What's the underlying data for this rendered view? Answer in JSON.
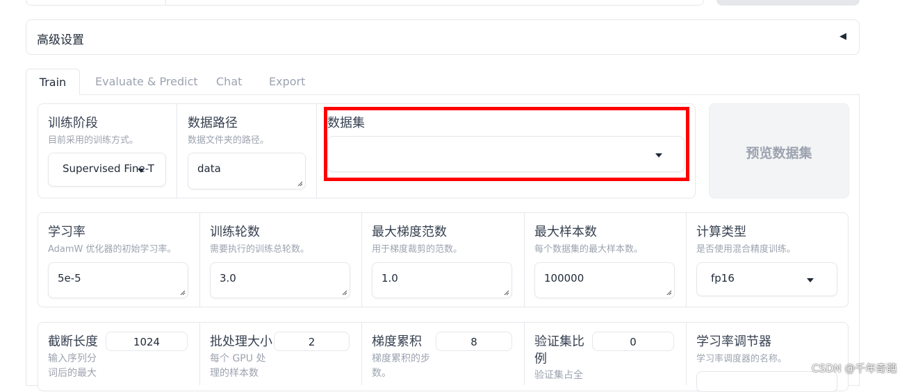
{
  "advanced": {
    "title": "高级设置"
  },
  "tabs": [
    "Train",
    "Evaluate & Predict",
    "Chat",
    "Export"
  ],
  "row1": {
    "stage": {
      "label": "训练阶段",
      "info": "目前采用的训练方式。",
      "value": "Supervised Fine-T"
    },
    "data_dir": {
      "label": "数据路径",
      "info": "数据文件夹的路径。",
      "value": "data"
    },
    "dataset": {
      "label": "数据集",
      "value": ""
    },
    "preview_button": "预览数据集"
  },
  "row2": [
    {
      "label": "学习率",
      "info": "AdamW 优化器的初始学习率。",
      "value": "5e-5"
    },
    {
      "label": "训练轮数",
      "info": "需要执行的训练总轮数。",
      "value": "3.0"
    },
    {
      "label": "最大梯度范数",
      "info": "用于梯度裁剪的范数。",
      "value": "1.0"
    },
    {
      "label": "最大样本数",
      "info": "每个数据集的最大样本数。",
      "value": "100000"
    },
    {
      "label": "计算类型",
      "info": "是否使用混合精度训练。",
      "value": "fp16"
    }
  ],
  "row3": {
    "cutoff": {
      "label": "截断长度",
      "value": "1024",
      "info_line1": "输入序列分",
      "info_line2": "词后的最大"
    },
    "batch": {
      "label": "批处理大小",
      "value": "2",
      "info_line1": "每个 GPU 处",
      "info_line2": "理的样本数"
    },
    "grad_acc": {
      "label": "梯度累积",
      "value": "8",
      "info_line1": "梯度累积的步",
      "info_line2": "数。"
    },
    "val_ratio": {
      "label_line1": "验证集比",
      "label_line2": "例",
      "value": "0",
      "info_line1": "验证集占全"
    },
    "scheduler": {
      "label": "学习率调节器",
      "info": "学习率调度器的名称。"
    }
  },
  "watermark": "CSDN @千年奇葩"
}
